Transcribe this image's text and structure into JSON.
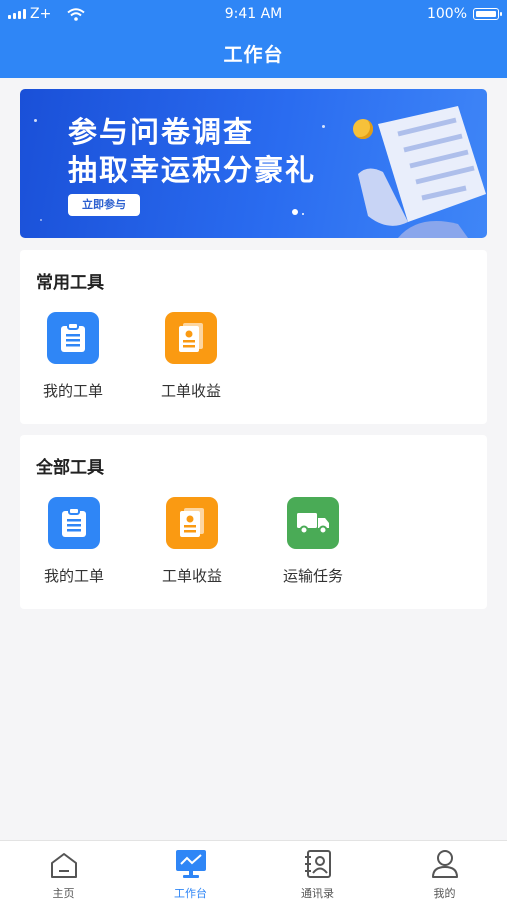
{
  "status_bar": {
    "carrier": "Z+",
    "time": "9:41 AM",
    "battery": "100%"
  },
  "header": {
    "title": "工作台"
  },
  "banner": {
    "line1": "参与问卷调查",
    "line2": "抽取幸运积分豪礼",
    "button": "立即参与"
  },
  "common_tools": {
    "title": "常用工具",
    "items": [
      {
        "label": "我的工单",
        "icon": "clipboard-icon",
        "color": "#2f86f6"
      },
      {
        "label": "工单收益",
        "icon": "document-icon",
        "color": "#fa9a12"
      }
    ]
  },
  "all_tools": {
    "title": "全部工具",
    "items": [
      {
        "label": "我的工单",
        "icon": "clipboard-icon",
        "color": "#2f86f6"
      },
      {
        "label": "工单收益",
        "icon": "document-icon",
        "color": "#fa9a12"
      },
      {
        "label": "运输任务",
        "icon": "truck-icon",
        "color": "#4aab56"
      }
    ]
  },
  "tabbar": {
    "items": [
      {
        "label": "主页",
        "icon": "home-icon"
      },
      {
        "label": "工作台",
        "icon": "workbench-icon",
        "active": true
      },
      {
        "label": "通讯录",
        "icon": "contacts-icon"
      },
      {
        "label": "我的",
        "icon": "user-icon"
      }
    ],
    "active_color": "#2f86f6"
  }
}
